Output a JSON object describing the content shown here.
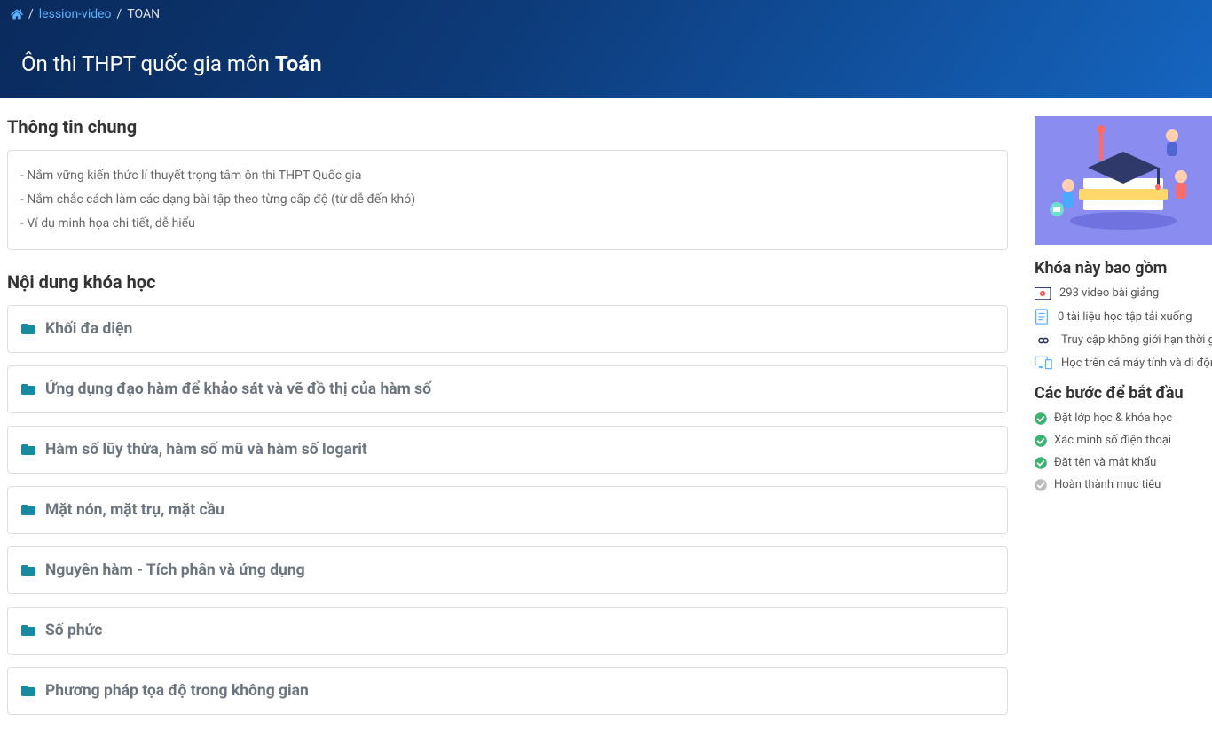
{
  "breadcrumb": {
    "home_aria": "Home",
    "link1": "lession-video",
    "current": "TOAN"
  },
  "page_title_prefix": "Ôn thi THPT quốc gia môn ",
  "page_title_bold": "Toán",
  "sections": {
    "general_info": "Thông tin chung",
    "course_content": "Nội dung khóa học"
  },
  "info_lines": [
    "- Nắm vững kiến thức lí thuyết trọng tâm ôn thi THPT Quốc gia",
    "- Nắm chắc cách làm các dạng bài tập theo từng cấp độ (từ dễ đến khó)",
    "- Ví dụ minh họa chi tiết, dễ hiểu"
  ],
  "chapters": [
    "Khối đa diện",
    "Ứng dụng đạo hàm để khảo sát và vẽ đồ thị của hàm số",
    "Hàm số lũy thừa, hàm số mũ và hàm số logarit",
    "Mặt nón, mặt trụ, mặt cầu",
    "Nguyên hàm - Tích phân và ứng dụng",
    "Số phức",
    "Phương pháp tọa độ trong không gian"
  ],
  "sidebar": {
    "includes_title": "Khóa này bao gồm",
    "includes": [
      "293 video bài giảng",
      "0 tài liệu học tập tải xuống",
      "Truy cập không giới hạn thời gian",
      "Học trên cả máy tính và di động"
    ],
    "steps_title": "Các bước để bắt đầu",
    "steps": [
      {
        "label": "Đặt lớp học & khóa học",
        "done": true
      },
      {
        "label": "Xác minh số điện thoại",
        "done": true
      },
      {
        "label": "Đặt tên và mật khẩu",
        "done": true
      },
      {
        "label": "Hoàn thành mục tiêu",
        "done": false
      }
    ]
  },
  "icons": {
    "video": "video-icon",
    "document": "document-icon",
    "infinity": "infinity-icon",
    "device": "device-icon"
  }
}
